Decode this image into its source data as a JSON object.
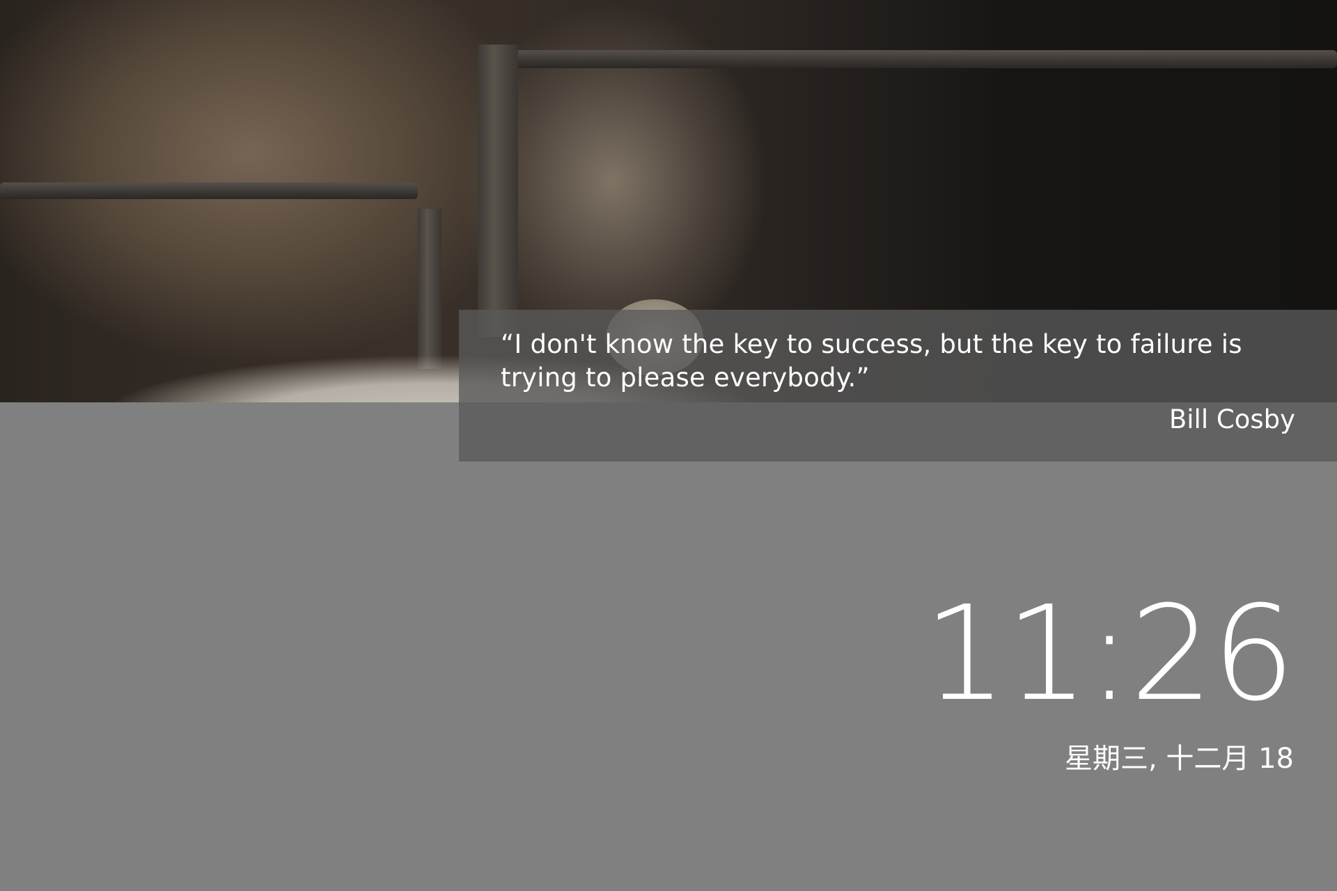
{
  "lock_screen": {
    "quote": {
      "text": "“I don't know the key to success, but the key to failure is trying to please everybody.”",
      "author": "Bill Cosby"
    },
    "clock": {
      "time": "11:26",
      "date": "星期三, 十二月 18"
    }
  }
}
